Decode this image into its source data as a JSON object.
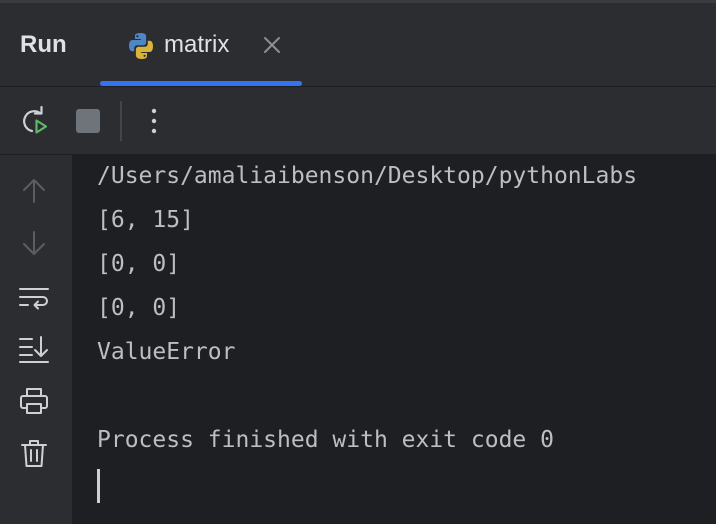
{
  "panel": {
    "title": "Run"
  },
  "tab": {
    "label": "matrix",
    "icon": "python-icon"
  },
  "toolbar": {
    "icons": [
      "rerun-icon",
      "stop-icon",
      "more-options-icon"
    ]
  },
  "sidebar": {
    "icons": [
      "arrow-up-icon",
      "arrow-down-icon",
      "soft-wrap-icon",
      "scroll-to-end-icon",
      "print-icon",
      "trash-icon"
    ]
  },
  "console": {
    "lines": [
      "/Users/amaliaibenson/Desktop/pythonLabs",
      "[6, 15]",
      "[0, 0]",
      "[0, 0]",
      "ValueError",
      "",
      "Process finished with exit code 0"
    ]
  },
  "colors": {
    "background": "#1e1f22",
    "panel": "#2b2d30",
    "accent": "#3574f0",
    "text": "#bcbec4",
    "run_green": "#5fb865"
  }
}
